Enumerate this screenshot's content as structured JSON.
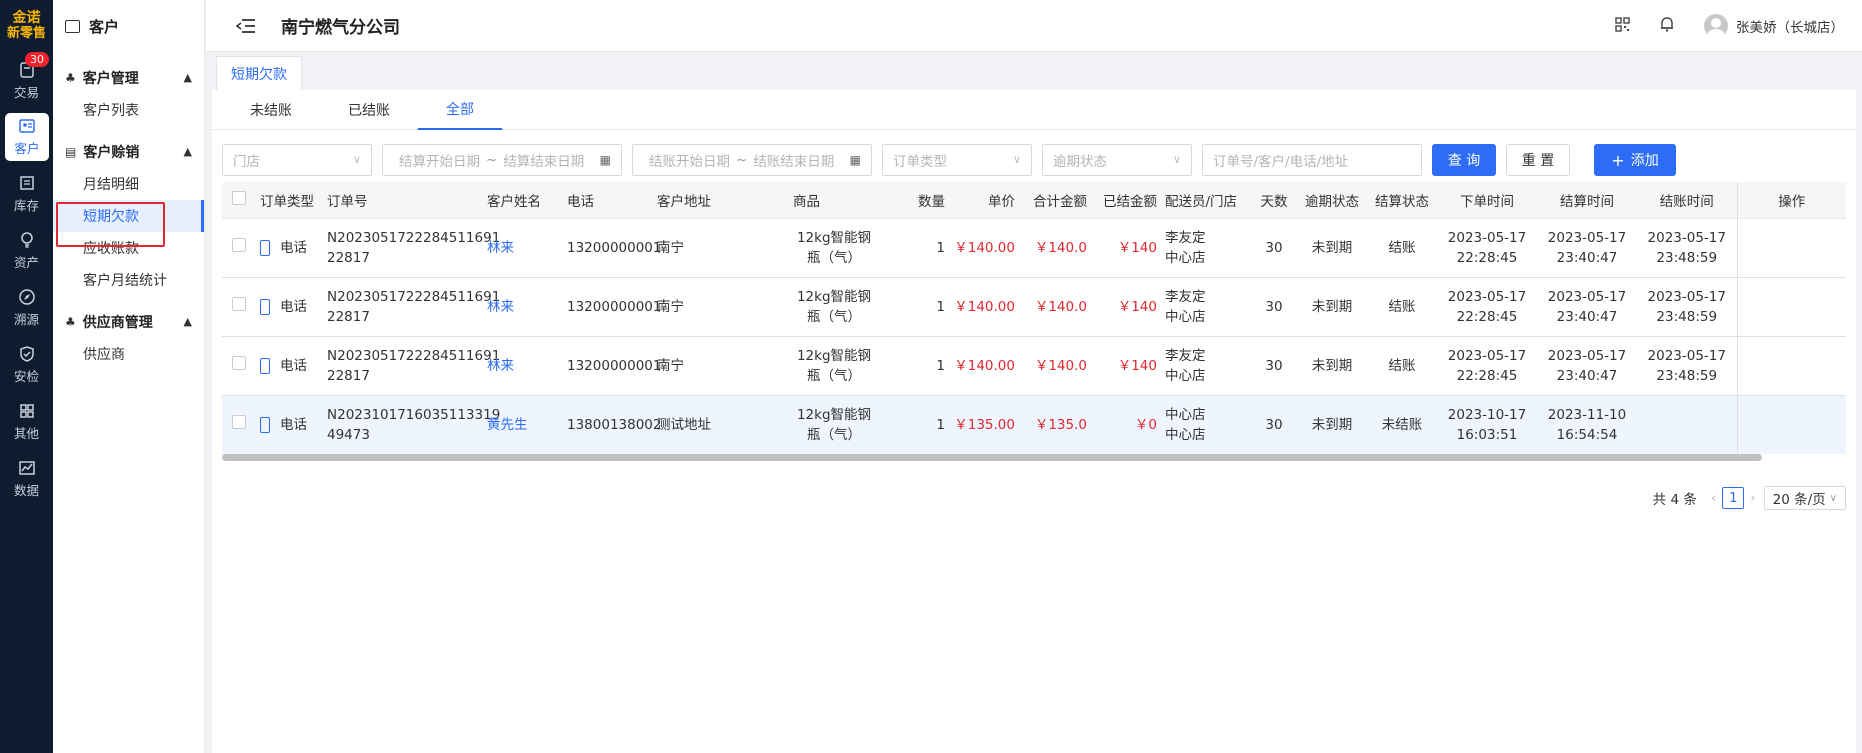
{
  "brand": {
    "line1": "金诺",
    "line2": "新零售"
  },
  "rail": [
    {
      "label": "交易",
      "icon": "trade-icon",
      "badge": "30"
    },
    {
      "label": "客户",
      "icon": "customer-icon",
      "active": true
    },
    {
      "label": "库存",
      "icon": "inventory-icon"
    },
    {
      "label": "资产",
      "icon": "asset-icon"
    },
    {
      "label": "溯源",
      "icon": "trace-icon"
    },
    {
      "label": "安检",
      "icon": "security-check-icon"
    },
    {
      "label": "其他",
      "icon": "other-icon"
    },
    {
      "label": "数据",
      "icon": "data-icon"
    }
  ],
  "sidenav": {
    "title": "客户",
    "groups": [
      {
        "label": "客户管理",
        "items": [
          "客户列表"
        ]
      },
      {
        "label": "客户赊销",
        "items": [
          "月结明细",
          "短期欠款",
          "应收账款",
          "客户月结统计"
        ]
      },
      {
        "label": "供应商管理",
        "items": [
          "供应商"
        ]
      }
    ]
  },
  "header": {
    "company": "南宁燃气分公司",
    "user": "张美娇（长城店）"
  },
  "page_tag": "短期欠款",
  "tabs": [
    "未结账",
    "已结账",
    "全部"
  ],
  "filters": {
    "store": "门店",
    "settle_start": "结算开始日期",
    "settle_end": "结算结束日期",
    "close_start": "结账开始日期",
    "close_end": "结账结束日期",
    "order_type": "订单类型",
    "overdue_status": "逾期状态",
    "keyword": "订单号/客户/电话/地址",
    "range_sep": "~",
    "query": "查 询",
    "reset": "重 置",
    "add": "添加"
  },
  "table": {
    "columns": [
      "订单类型",
      "订单号",
      "客户姓名",
      "电话",
      "客户地址",
      "商品",
      "数量",
      "单价",
      "合计金额",
      "已结金额",
      "配送员/门店",
      "天数",
      "逾期状态",
      "结算状态",
      "下单时间",
      "结算时间",
      "结账时间",
      "操作"
    ],
    "rows": [
      {
        "type": "电话",
        "order_no": "N2023051722284511691 22817",
        "customer": "林来",
        "phone": "13200000001",
        "address": "南宁",
        "product": "12kg智能钢瓶（气）",
        "qty": "1",
        "price": "￥140.00",
        "total": "￥140.0",
        "settled": "￥140",
        "courier": "李友定",
        "store": "中心店",
        "days": "30",
        "overdue": "未到期",
        "settle_status": "结账",
        "order_date": "2023-05-17",
        "order_time": "22:28:45",
        "settle_date": "2023-05-17",
        "settle_time": "23:40:47",
        "close_date": "2023-05-17",
        "close_time": "23:48:59"
      },
      {
        "type": "电话",
        "order_no": "N2023051722284511691 22817",
        "customer": "林来",
        "phone": "13200000001",
        "address": "南宁",
        "product": "12kg智能钢瓶（气）",
        "qty": "1",
        "price": "￥140.00",
        "total": "￥140.0",
        "settled": "￥140",
        "courier": "李友定",
        "store": "中心店",
        "days": "30",
        "overdue": "未到期",
        "settle_status": "结账",
        "order_date": "2023-05-17",
        "order_time": "22:28:45",
        "settle_date": "2023-05-17",
        "settle_time": "23:40:47",
        "close_date": "2023-05-17",
        "close_time": "23:48:59"
      },
      {
        "type": "电话",
        "order_no": "N2023051722284511691 22817",
        "customer": "林来",
        "phone": "13200000001",
        "address": "南宁",
        "product": "12kg智能钢瓶（气）",
        "qty": "1",
        "price": "￥140.00",
        "total": "￥140.0",
        "settled": "￥140",
        "courier": "李友定",
        "store": "中心店",
        "days": "30",
        "overdue": "未到期",
        "settle_status": "结账",
        "order_date": "2023-05-17",
        "order_time": "22:28:45",
        "settle_date": "2023-05-17",
        "settle_time": "23:40:47",
        "close_date": "2023-05-17",
        "close_time": "23:48:59"
      },
      {
        "type": "电话",
        "order_no": "N2023101716035113319 49473",
        "customer": "黄先生",
        "phone": "13800138002",
        "address": "测试地址",
        "product": "12kg智能钢瓶（气）",
        "qty": "1",
        "price": "￥135.00",
        "total": "￥135.0",
        "settled": "￥0",
        "courier": "中心店",
        "store": "中心店",
        "days": "30",
        "overdue": "未到期",
        "settle_status": "未结账",
        "order_date": "2023-10-17",
        "order_time": "16:03:51",
        "settle_date": "2023-11-10",
        "settle_time": "16:54:54",
        "close_date": "",
        "close_time": ""
      }
    ]
  },
  "pager": {
    "total": "共 4 条",
    "page": "1",
    "size": "20 条/页",
    "prev": "‹",
    "next": "›"
  }
}
